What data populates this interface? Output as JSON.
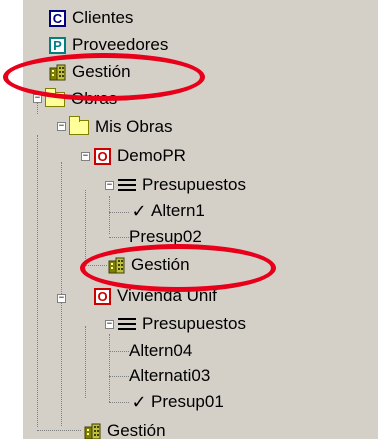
{
  "tree": {
    "clientes": {
      "label": "Clientes",
      "icon": "client-c-icon"
    },
    "proveedores": {
      "label": "Proveedores",
      "icon": "supplier-p-icon"
    },
    "gestion_root": {
      "label": "Gestión",
      "icon": "building-icon"
    },
    "obras": {
      "label": "Obras",
      "icon": "folder-icon"
    },
    "mis_obras": {
      "label": "Mis Obras",
      "icon": "folder-icon"
    },
    "demopr": {
      "label": "DemoPR",
      "icon": "obra-o-icon",
      "presupuestos": {
        "label": "Presupuestos",
        "icon": "list-icon"
      },
      "items": [
        {
          "label": "Altern1",
          "checked": true
        },
        {
          "label": "Presup02",
          "checked": false
        }
      ],
      "gestion": {
        "label": "Gestión",
        "icon": "building-icon"
      }
    },
    "vivienda": {
      "label": "Vivienda Unif",
      "icon": "obra-o-icon",
      "presupuestos": {
        "label": "Presupuestos",
        "icon": "list-icon"
      },
      "items": [
        {
          "label": "Altern04",
          "checked": false
        },
        {
          "label": "Alternati03",
          "checked": false
        },
        {
          "label": "Presup01",
          "checked": true
        }
      ],
      "gestion": {
        "label": "Gestión",
        "icon": "building-icon"
      }
    },
    "glyphs": {
      "letter_c": "C",
      "letter_p": "P",
      "letter_o": "O",
      "check": "✓",
      "minus": "−"
    }
  },
  "colors": {
    "highlight": "#e8001a",
    "panel": "#d4d0c8"
  }
}
